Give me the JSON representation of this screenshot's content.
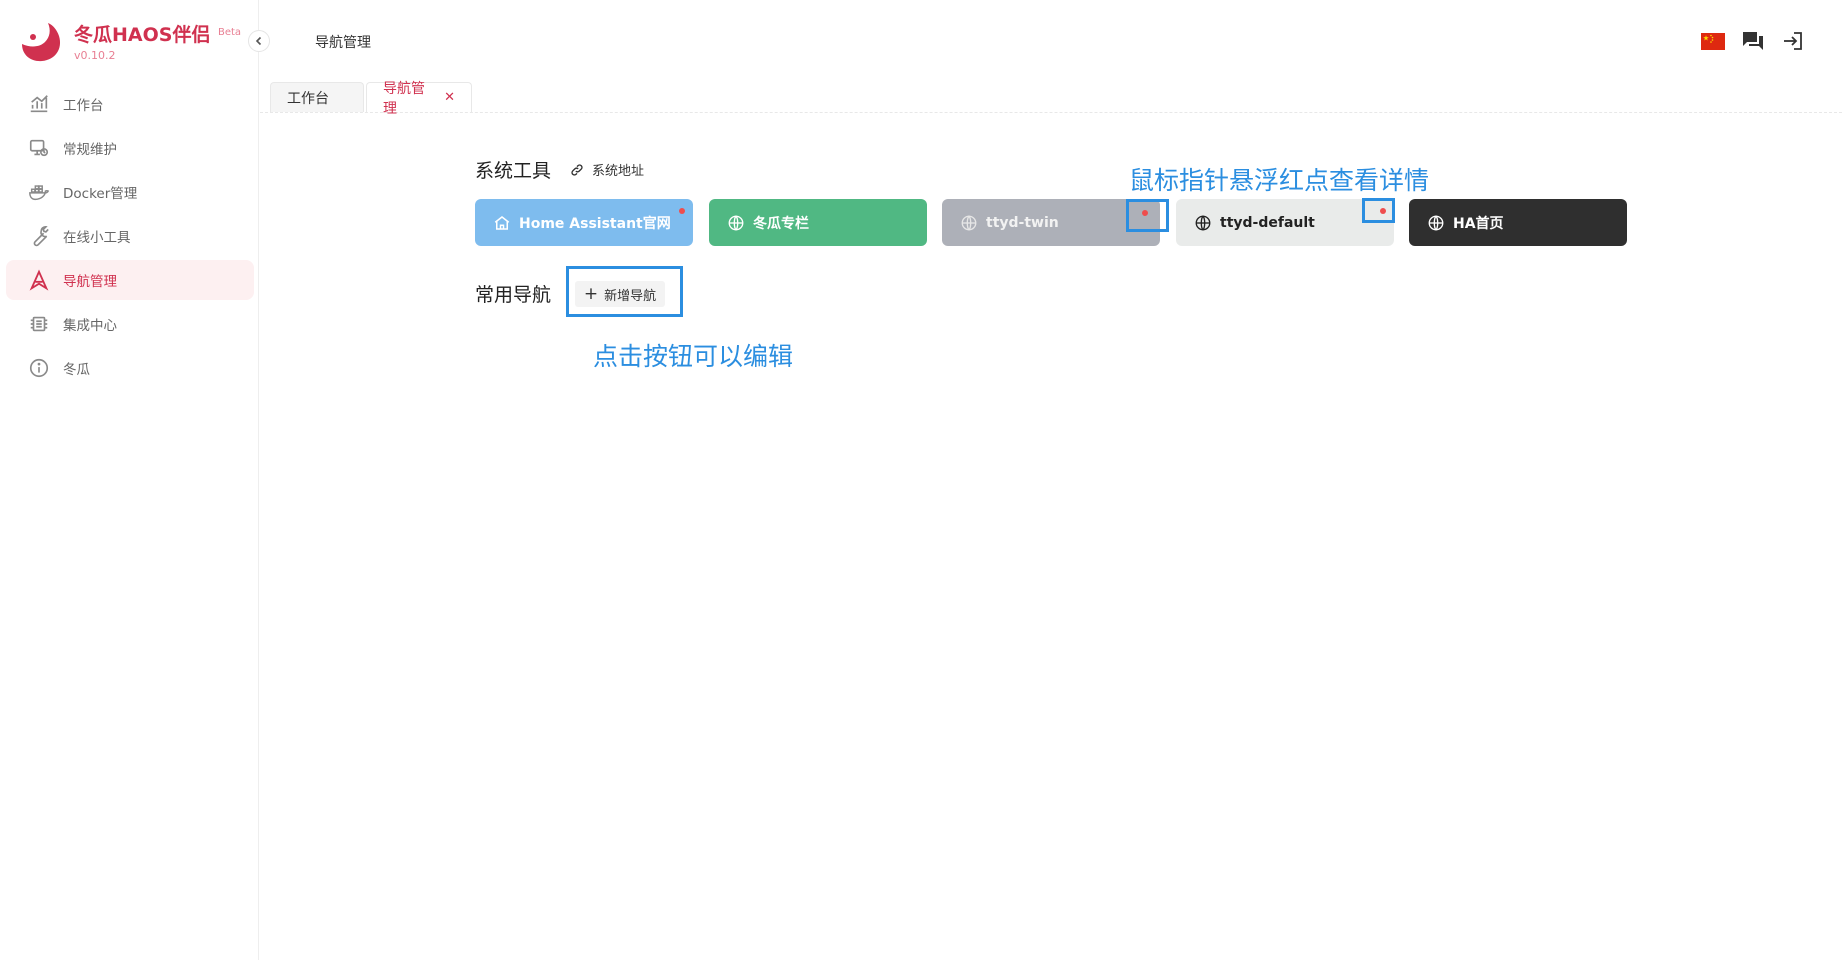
{
  "brand": {
    "title": "冬瓜HAOS伴侣",
    "badge": "Beta",
    "version": "v0.10.2"
  },
  "sidebar": {
    "items": [
      {
        "label": "工作台",
        "icon": "chart-icon"
      },
      {
        "label": "常规维护",
        "icon": "maintenance-icon"
      },
      {
        "label": "Docker管理",
        "icon": "docker-icon"
      },
      {
        "label": "在线小工具",
        "icon": "wrench-icon"
      },
      {
        "label": "导航管理",
        "icon": "navigation-icon",
        "active": true
      },
      {
        "label": "集成中心",
        "icon": "chip-icon"
      },
      {
        "label": "冬瓜",
        "icon": "info-icon"
      }
    ]
  },
  "header": {
    "title": "导航管理"
  },
  "tabs": [
    {
      "label": "工作台"
    },
    {
      "label": "导航管理",
      "close": "✕",
      "active": true
    }
  ],
  "main": {
    "system_tools_title": "系统工具",
    "system_address_link": "系统地址",
    "tools": [
      {
        "label": "Home Assistant官网",
        "bg": "#7ebcee",
        "fg": "#ffffff",
        "icon": "home-icon"
      },
      {
        "label": "冬瓜专栏",
        "bg": "#50b883",
        "fg": "#ffffff",
        "icon": "globe-icon"
      },
      {
        "label": "ttyd-twin",
        "bg": "#adb0b8",
        "fg": "#f2f2f2",
        "icon": "globe-icon"
      },
      {
        "label": "ttyd-default",
        "bg": "#e9ebea",
        "fg": "#222222",
        "icon": "globe-icon"
      },
      {
        "label": "HA首页",
        "bg": "#2f2f2f",
        "fg": "#ffffff",
        "icon": "globe-icon"
      }
    ],
    "common_nav_title": "常用导航",
    "add_nav_button": "新增导航"
  },
  "annotations": {
    "hover_tip": "鼠标指针悬浮红点查看详情",
    "click_tip": "点击按钮可以编辑"
  },
  "colors": {
    "accent": "#d0314f",
    "annotation": "#2b8ee0",
    "dot": "#ef4d4d"
  }
}
